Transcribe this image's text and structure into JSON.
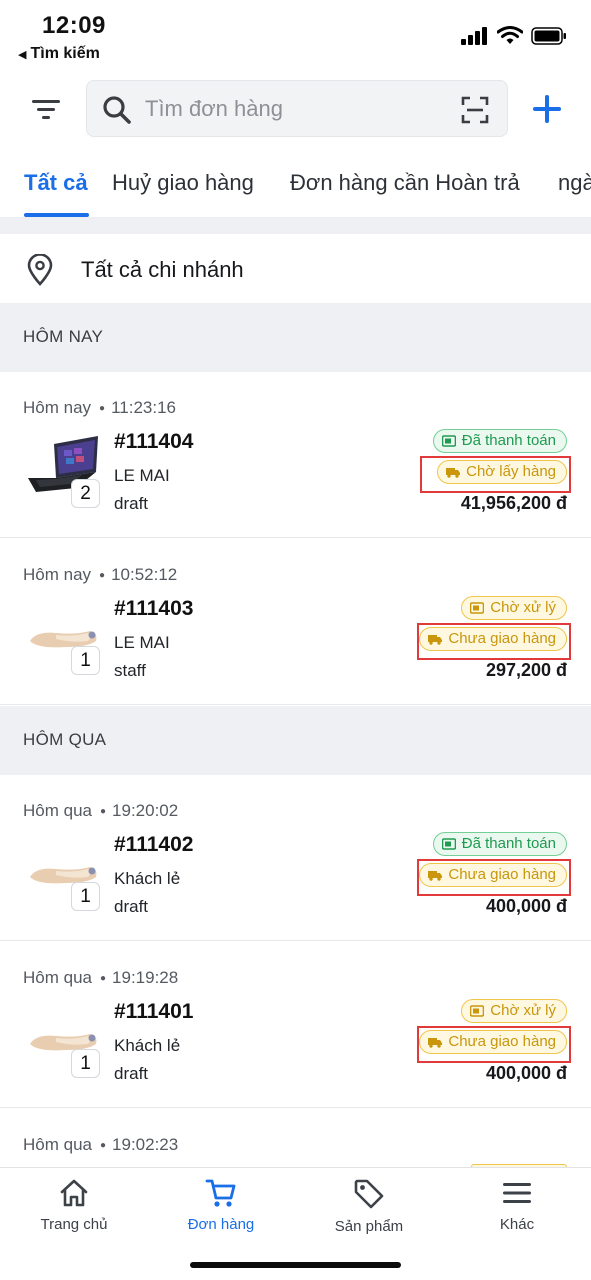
{
  "status_bar": {
    "time": "12:09",
    "back_app": "Tìm kiếm"
  },
  "search": {
    "placeholder": "Tìm đơn hàng"
  },
  "tabs": [
    {
      "label": "Tất cả"
    },
    {
      "label": "Huỷ giao hàng"
    },
    {
      "label": "Đơn hàng cần Hoàn trả"
    },
    {
      "label": "ngà"
    }
  ],
  "branch": {
    "label": "Tất cả chi nhánh"
  },
  "sections": {
    "today": "HÔM NAY",
    "yesterday": "HÔM QUA"
  },
  "orders": [
    {
      "day": "Hôm nay",
      "time": "11:23:16",
      "code": "#111404",
      "customer": "LE MAI",
      "source": "draft",
      "qty": "2",
      "payment_status": "Đã thanh toán",
      "shipping_status": "Chờ lấy hàng",
      "total": "41,956,200 đ",
      "product": "laptop"
    },
    {
      "day": "Hôm nay",
      "time": "10:52:12",
      "code": "#111403",
      "customer": "LE MAI",
      "source": "staff",
      "qty": "1",
      "payment_status": "Chờ xử lý",
      "shipping_status": "Chưa giao hàng",
      "total": "297,200 đ",
      "product": "shoe"
    },
    {
      "day": "Hôm qua",
      "time": "19:20:02",
      "code": "#111402",
      "customer": "Khách lẻ",
      "source": "draft",
      "qty": "1",
      "payment_status": "Đã thanh toán",
      "shipping_status": "Chưa giao hàng",
      "total": "400,000 đ",
      "product": "shoe"
    },
    {
      "day": "Hôm qua",
      "time": "19:19:28",
      "code": "#111401",
      "customer": "Khách lẻ",
      "source": "draft",
      "qty": "1",
      "payment_status": "Chờ xử lý",
      "shipping_status": "Chưa giao hàng",
      "total": "400,000 đ",
      "product": "shoe"
    },
    {
      "day": "Hôm qua",
      "time": "19:02:23"
    }
  ],
  "bottom_nav": [
    {
      "label": "Trang chủ",
      "icon": "home-icon"
    },
    {
      "label": "Đơn hàng",
      "icon": "cart-icon",
      "active": true
    },
    {
      "label": "Sản phẩm",
      "icon": "tag-icon"
    },
    {
      "label": "Khác",
      "icon": "menu-icon"
    }
  ],
  "colors": {
    "accent": "#1a6ee8",
    "paid": "#1f9a50",
    "pending": "#c9960c",
    "highlight": "#e23a3a"
  }
}
